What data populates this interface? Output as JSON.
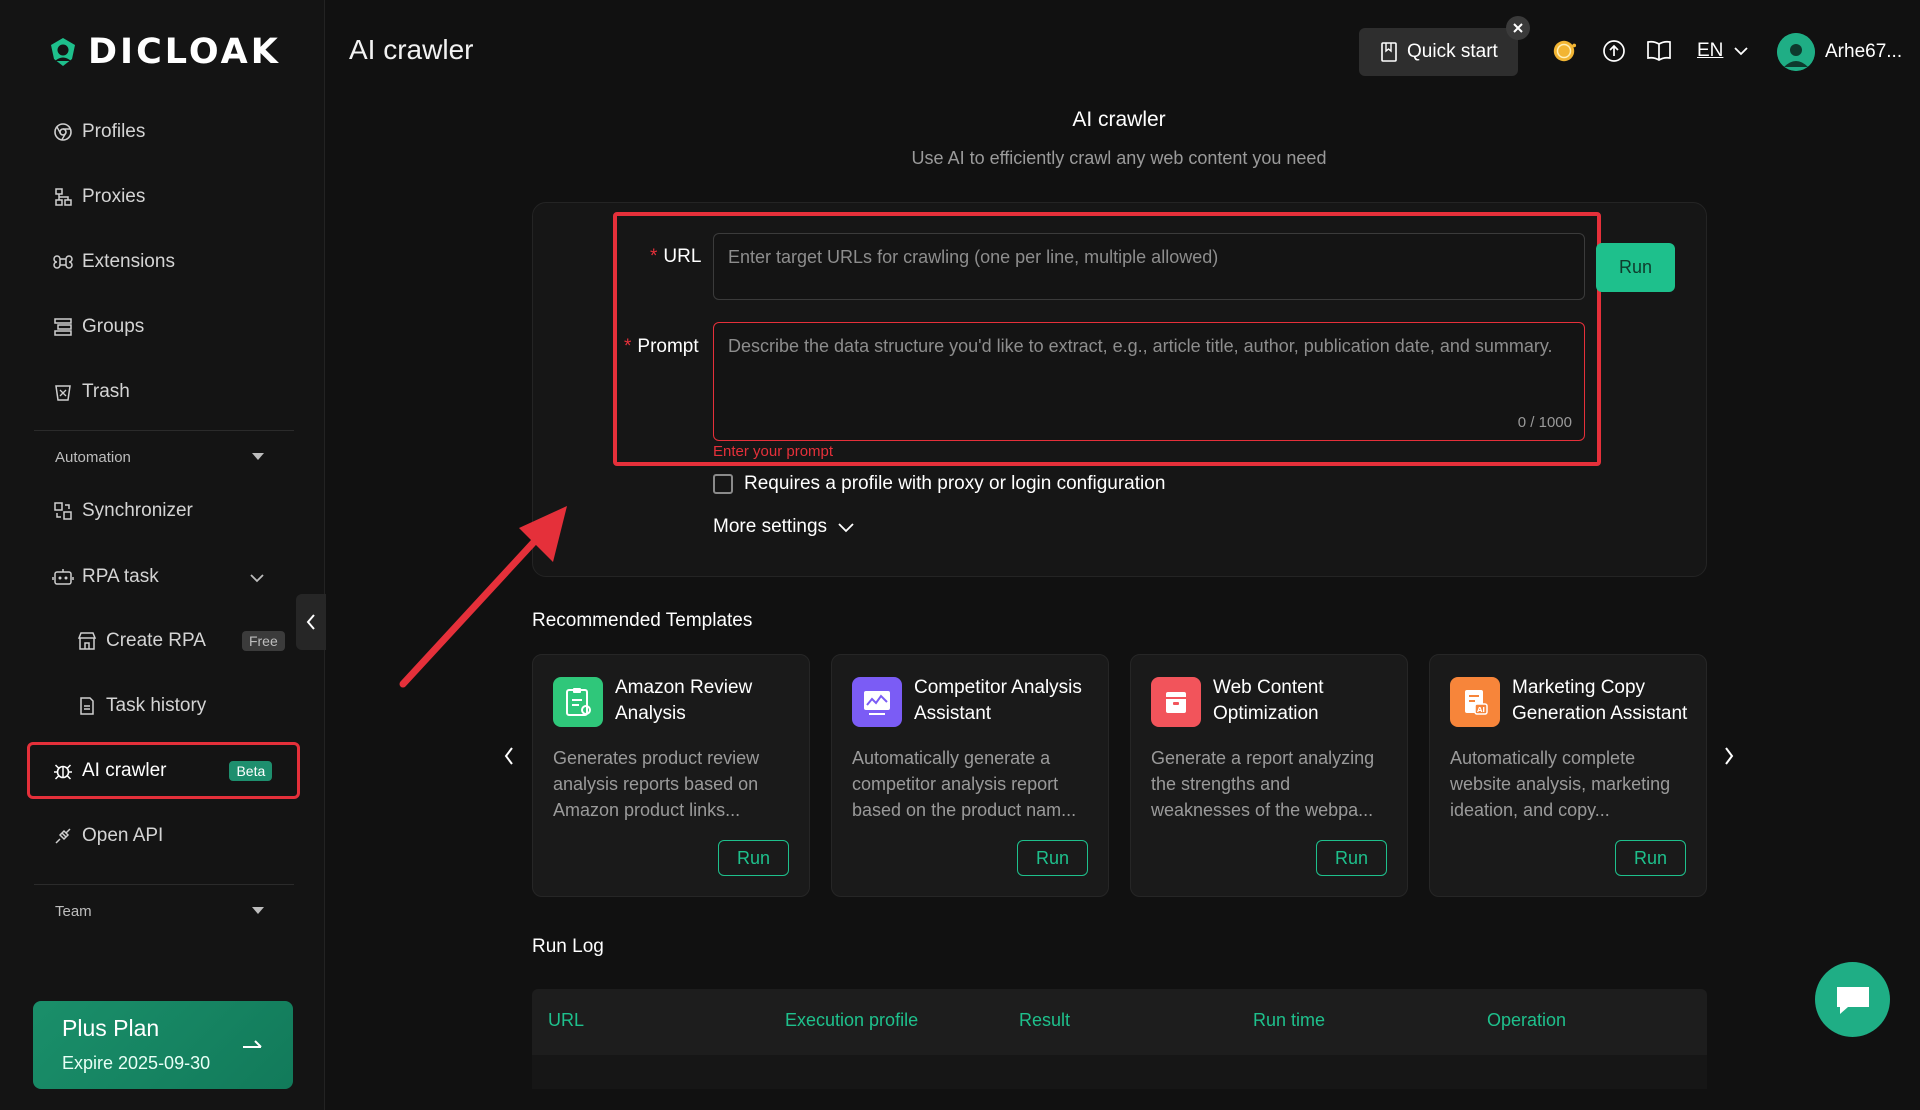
{
  "app": {
    "name": "DICLOAK",
    "page_title": "AI crawler"
  },
  "sidebar": {
    "items": [
      {
        "label": "Profiles",
        "icon": "chrome-icon"
      },
      {
        "label": "Proxies",
        "icon": "network-icon"
      },
      {
        "label": "Extensions",
        "icon": "command-icon"
      },
      {
        "label": "Groups",
        "icon": "groups-icon"
      },
      {
        "label": "Trash",
        "icon": "trash-icon"
      }
    ],
    "automation_label": "Automation",
    "synchronizer_label": "Synchronizer",
    "rpa_task_label": "RPA task",
    "create_rpa_label": "Create RPA",
    "free_badge": "Free",
    "task_history_label": "Task history",
    "ai_crawler_label": "AI crawler",
    "beta_badge": "Beta",
    "open_api_label": "Open API",
    "team_label": "Team",
    "plan": {
      "name": "Plus Plan",
      "expire": "Expire 2025-09-30"
    }
  },
  "header": {
    "quick_start": "Quick start",
    "language": "EN",
    "username": "Arhe67..."
  },
  "main": {
    "title": "AI crawler",
    "subtitle": "Use AI to efficiently crawl any web content you need",
    "url_label": "URL",
    "url_placeholder": "Enter target URLs for crawling (one per line, multiple allowed)",
    "prompt_label": "Prompt",
    "prompt_placeholder": "Describe the data structure you'd like to extract, e.g., article title, author, publication date, and summary.",
    "prompt_counter": "0 / 1000",
    "prompt_error": "Enter your prompt",
    "run_label": "Run",
    "checkbox_label": "Requires a profile with proxy or login configuration",
    "more_settings": "More settings"
  },
  "templates": {
    "title": "Recommended Templates",
    "items": [
      {
        "title": "Amazon Review Analysis",
        "desc": "Generates product review analysis reports based on Amazon product links...",
        "run": "Run",
        "color": "#2fc77a"
      },
      {
        "title": "Competitor Analysis Assistant",
        "desc": "Automatically generate a competitor analysis report based on the product nam...",
        "run": "Run",
        "color": "#7b5cf5"
      },
      {
        "title": "Web Content Optimization",
        "desc": "Generate a report analyzing the strengths and weaknesses of the webpa...",
        "run": "Run",
        "color": "#f2545b"
      },
      {
        "title": "Marketing Copy Generation Assistant",
        "desc": "Automatically complete website analysis, marketing ideation, and copy...",
        "run": "Run",
        "color": "#f7853a"
      }
    ]
  },
  "run_log": {
    "title": "Run Log",
    "columns": [
      "URL",
      "Execution profile",
      "Result",
      "Run time",
      "Operation"
    ]
  },
  "colors": {
    "accent": "#1ec08c",
    "annotation": "#e5303a",
    "background": "#111111"
  }
}
